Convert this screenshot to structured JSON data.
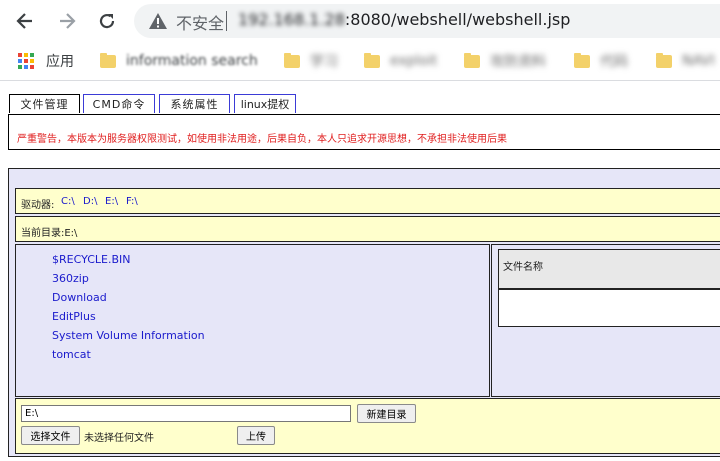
{
  "browser": {
    "security_label": "不安全",
    "url_host": "192.168.1.28",
    "url_rest": ":8080/webshell/webshell.jsp",
    "icons": {
      "back": "back-arrow-icon",
      "forward": "forward-arrow-icon",
      "reload": "reload-icon",
      "warning": "warning-icon"
    }
  },
  "bookmarks": {
    "apps_label": "应用",
    "items": [
      {
        "label": "information search",
        "blurred": true
      },
      {
        "label": "学习",
        "blurred": true
      },
      {
        "label": "exploit",
        "blurred": true
      },
      {
        "label": "攻防资料",
        "blurred": true
      },
      {
        "label": "代码",
        "blurred": true
      },
      {
        "label": "NAVI",
        "blurred": true
      }
    ],
    "folder_color": "#f3d16a"
  },
  "tabs": [
    {
      "label": "文件管理"
    },
    {
      "label": "CMD命令"
    },
    {
      "label": "系统属性"
    },
    {
      "label": "linux提权"
    }
  ],
  "warning": "严重警告，本版本为服务器权限测试，如使用非法用途，后果自负，本人只追求开源思想，不承担非法使用后果",
  "drives": {
    "label": "驱动器:",
    "items": [
      "C:\\",
      "D:\\",
      "E:\\",
      "F:\\"
    ]
  },
  "current_dir": "当前目录:E:\\",
  "files": [
    "$RECYCLE.BIN",
    "360zip",
    "Download",
    "EditPlus",
    "System Volume Information",
    "tomcat"
  ],
  "file_name_header": "文件名称",
  "controls": {
    "path_value": "E:\\",
    "new_dir_button": "新建目录",
    "choose_file_button": "选择文件",
    "no_file_text": "未选择任何文件",
    "upload_button": "上传"
  },
  "colors": {
    "link": "#1a1acc",
    "warning": "#e02020",
    "panel_bg": "#e6e6f8",
    "row_bg": "#ffffcc"
  }
}
